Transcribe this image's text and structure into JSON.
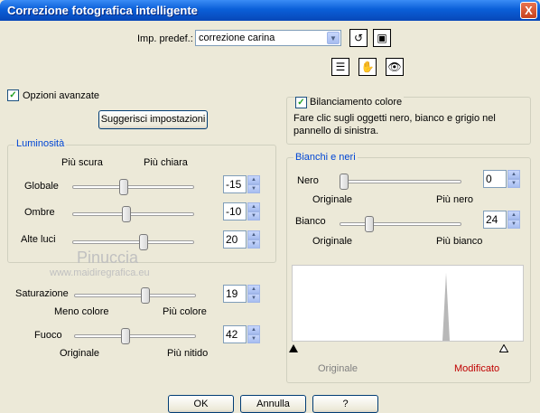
{
  "window": {
    "title": "Correzione fotografica intelligente",
    "close_glyph": "X"
  },
  "preset": {
    "label": "Imp. predef.:",
    "value": "correzione carina"
  },
  "advanced": {
    "label": "Opzioni avanzate",
    "checked": true
  },
  "suggest_button": "Suggerisci impostazioni",
  "brightness": {
    "title": "Luminosità",
    "darker": "Più scura",
    "lighter": "Più chiara",
    "rows": [
      {
        "label": "Globale",
        "value": "-15"
      },
      {
        "label": "Ombre",
        "value": "-10"
      },
      {
        "label": "Alte luci",
        "value": "20"
      }
    ]
  },
  "saturation": {
    "label": "Saturazione",
    "value": "19",
    "left": "Meno colore",
    "right": "Più colore"
  },
  "focus": {
    "label": "Fuoco",
    "value": "42",
    "left": "Originale",
    "right": "Più nitido"
  },
  "color_balance": {
    "label": "Bilanciamento colore",
    "checked": true,
    "text": "Fare clic sugli oggetti nero, bianco e grigio nel pannello di sinistra."
  },
  "black_white": {
    "title": "Bianchi e neri",
    "black": {
      "label": "Nero",
      "value": "0",
      "left": "Originale",
      "right": "Più nero"
    },
    "white": {
      "label": "Bianco",
      "value": "24",
      "left": "Originale",
      "right": "Più bianco"
    }
  },
  "histogram": {
    "left_label": "Originale",
    "right_label": "Modificato",
    "right_color": "#c00000"
  },
  "buttons": {
    "ok": "OK",
    "cancel": "Annulla",
    "help": "?"
  },
  "watermark": {
    "line1": "Pinuccia",
    "line2": "www.maidiregrafica.eu"
  }
}
